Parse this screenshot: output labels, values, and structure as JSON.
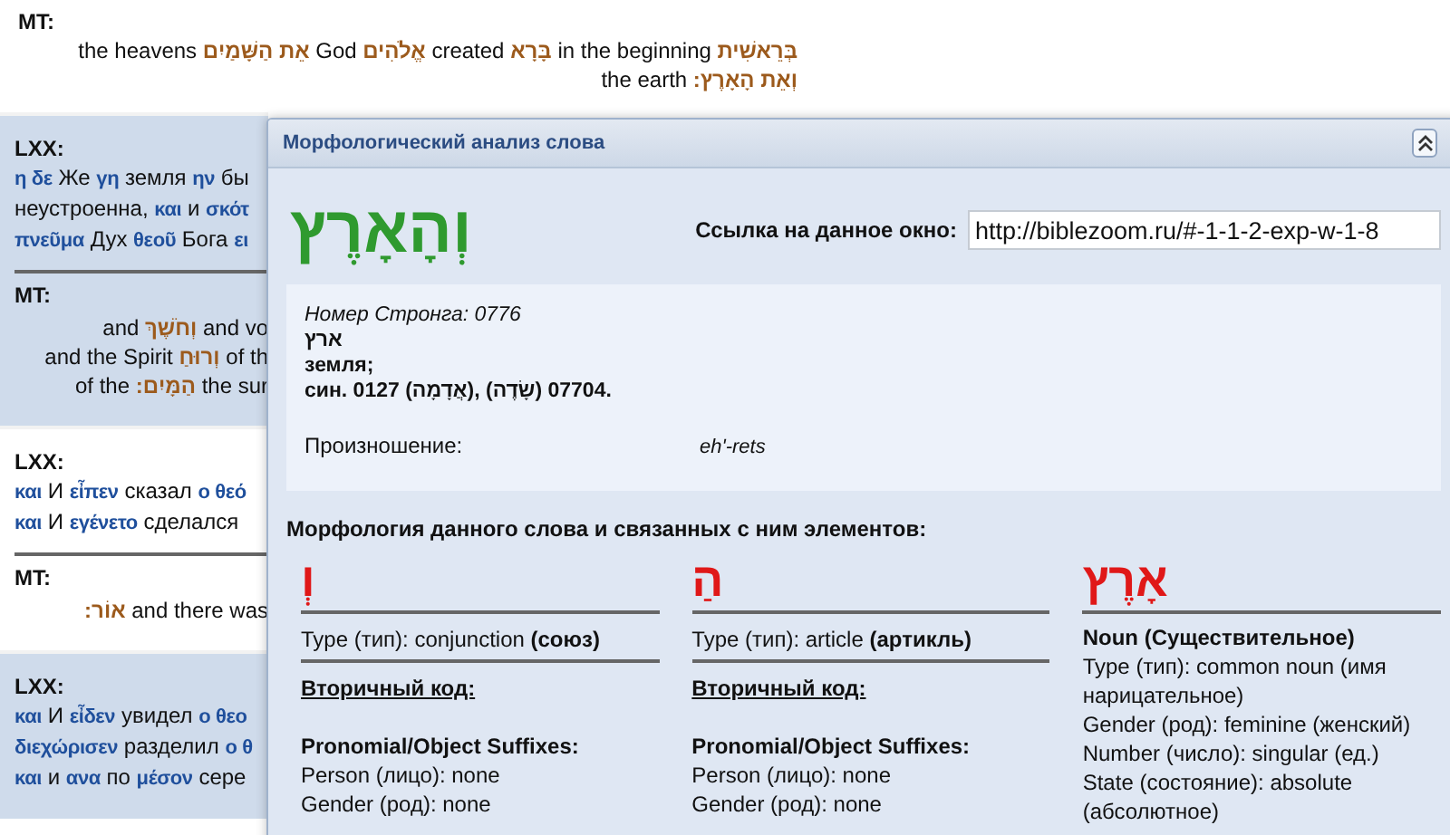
{
  "top_verse": {
    "label": "MT:",
    "lines": [
      [
        {
          "kind": "en",
          "text": "the heavens"
        },
        {
          "kind": "heb",
          "text": "אֵת הַשָּׁמַיִם"
        },
        {
          "kind": "en",
          "text": "God"
        },
        {
          "kind": "heb",
          "text": "אֱלֹהִים"
        },
        {
          "kind": "en",
          "text": "created"
        },
        {
          "kind": "heb",
          "text": "בָּרָא"
        },
        {
          "kind": "en",
          "text": "in the beginning"
        },
        {
          "kind": "heb",
          "text": "בְּרֵאשִׁית"
        }
      ],
      [
        {
          "kind": "en",
          "text": "the earth"
        },
        {
          "kind": "heb",
          "text": "וְאֵת הָאָרֶץ:"
        }
      ]
    ]
  },
  "blocks": [
    {
      "shaded": true,
      "sections": [
        {
          "kind": "lxx",
          "label": "LXX:",
          "lines": [
            [
              {
                "kind": "greek",
                "text": "η δε"
              },
              {
                "kind": "ru",
                "text": "Же"
              },
              {
                "kind": "greek",
                "text": "γη"
              },
              {
                "kind": "ru",
                "text": "земля"
              },
              {
                "kind": "greek",
                "text": "ην"
              },
              {
                "kind": "ru",
                "text": "бы"
              }
            ],
            [
              {
                "kind": "ru",
                "text": "неустроенна,"
              },
              {
                "kind": "greek",
                "text": "και"
              },
              {
                "kind": "ru",
                "text": "и"
              },
              {
                "kind": "greek",
                "text": "σκότ"
              }
            ],
            [
              {
                "kind": "greek",
                "text": "πνεῦμα"
              },
              {
                "kind": "ru",
                "text": "Дух"
              },
              {
                "kind": "greek",
                "text": "θεοῦ"
              },
              {
                "kind": "ru",
                "text": "Бога"
              },
              {
                "kind": "greek",
                "text": "ει"
              }
            ]
          ]
        },
        {
          "kind": "mt",
          "label": "MT:",
          "lines": [
            [
              {
                "kind": "en",
                "text": "and"
              },
              {
                "kind": "heb",
                "text": "וְחֹשֶׁךְ"
              },
              {
                "kind": "en",
                "text": "and vo"
              }
            ],
            [
              {
                "kind": "en",
                "text": "and the Spirit"
              },
              {
                "kind": "heb",
                "text": "וְרוּחַ"
              },
              {
                "kind": "en",
                "text": "of th"
              }
            ],
            [
              {
                "kind": "en",
                "text": "of the"
              },
              {
                "kind": "heb",
                "text": "הַמָּיִם:"
              },
              {
                "kind": "en",
                "text": "the sur"
              }
            ]
          ]
        }
      ]
    },
    {
      "shaded": false,
      "sections": [
        {
          "kind": "lxx",
          "label": "LXX:",
          "lines": [
            [
              {
                "kind": "greek",
                "text": "και"
              },
              {
                "kind": "ru",
                "text": "И"
              },
              {
                "kind": "greek",
                "text": "εἶπεν"
              },
              {
                "kind": "ru",
                "text": "сказал"
              },
              {
                "kind": "greek",
                "text": "ο θεό"
              }
            ],
            [
              {
                "kind": "greek",
                "text": "και"
              },
              {
                "kind": "ru",
                "text": "И"
              },
              {
                "kind": "greek",
                "text": "εγένετο"
              },
              {
                "kind": "ru",
                "text": "сделался"
              }
            ]
          ]
        },
        {
          "kind": "mt",
          "label": "MT:",
          "lines": [
            [
              {
                "kind": "heb",
                "text": "אוֹר:"
              },
              {
                "kind": "en",
                "text": "and there was"
              }
            ]
          ]
        }
      ]
    },
    {
      "shaded": true,
      "sections": [
        {
          "kind": "lxx",
          "label": "LXX:",
          "lines": [
            [
              {
                "kind": "greek",
                "text": "και"
              },
              {
                "kind": "ru",
                "text": "И"
              },
              {
                "kind": "greek",
                "text": "εἶδεν"
              },
              {
                "kind": "ru",
                "text": "увидел"
              },
              {
                "kind": "greek",
                "text": "ο θεο"
              }
            ],
            [
              {
                "kind": "greek",
                "text": "διεχώρισεν"
              },
              {
                "kind": "ru",
                "text": "разделил"
              },
              {
                "kind": "greek",
                "text": "ο θ"
              }
            ],
            [
              {
                "kind": "greek",
                "text": "και"
              },
              {
                "kind": "ru",
                "text": "и"
              },
              {
                "kind": "greek",
                "text": "ανα"
              },
              {
                "kind": "ru",
                "text": "по"
              },
              {
                "kind": "greek",
                "text": "μέσον"
              },
              {
                "kind": "ru",
                "text": "сере"
              }
            ]
          ]
        }
      ]
    }
  ],
  "dialog": {
    "title": "Морфологический анализ слова",
    "word": "וְהָאָרֶץ",
    "link_label": "Ссылка на данное окно:",
    "link_value": "http://biblezoom.ru/#-1-1-2-exp-w-1-8",
    "strong_number": "Номер Стронга: 0776",
    "lemma": "ארץ",
    "meaning": "земля;",
    "synonyms": "син. 0127 (אֲדָמָה), 07704 (שָׂדֶה).",
    "pronunciation_label": "Произношение:",
    "pronunciation": "eh'-rets",
    "morphology_heading": "Морфология данного слова и связанных с ним элементов:",
    "columns": [
      {
        "lines": [
          {
            "kind": "word",
            "text": "וְ"
          },
          {
            "kind": "ruled",
            "text": "Type (тип): conjunction **(союз)**"
          },
          {
            "kind": "underlined",
            "text": "Вторичный код:"
          },
          {
            "kind": "bold",
            "text": "Pronomial/Object Suffixes:"
          },
          {
            "kind": "plain",
            "text": "Person (лицо): none"
          },
          {
            "kind": "plain",
            "text": "Gender (род): none"
          }
        ]
      },
      {
        "lines": [
          {
            "kind": "word",
            "text": "הַ"
          },
          {
            "kind": "ruled",
            "text": "Type (тип): article **(артикль)**"
          },
          {
            "kind": "underlined",
            "text": "Вторичный код:"
          },
          {
            "kind": "bold",
            "text": "Pronomial/Object Suffixes:"
          },
          {
            "kind": "plain",
            "text": "Person (лицо): none"
          },
          {
            "kind": "plain",
            "text": "Gender (род): none"
          }
        ]
      },
      {
        "lines": [
          {
            "kind": "word",
            "text": "אָרֶץ"
          },
          {
            "kind": "heading",
            "text": "Noun (Существительное)"
          },
          {
            "kind": "plain",
            "text": "Type (тип): common noun (имя нарицательное)"
          },
          {
            "kind": "plain",
            "text": "Gender (род): feminine (женский)"
          },
          {
            "kind": "plain",
            "text": "Number (число): singular (ед.)"
          },
          {
            "kind": "plain",
            "text": "State (состояние): absolute (абсолютное)"
          }
        ]
      }
    ]
  }
}
